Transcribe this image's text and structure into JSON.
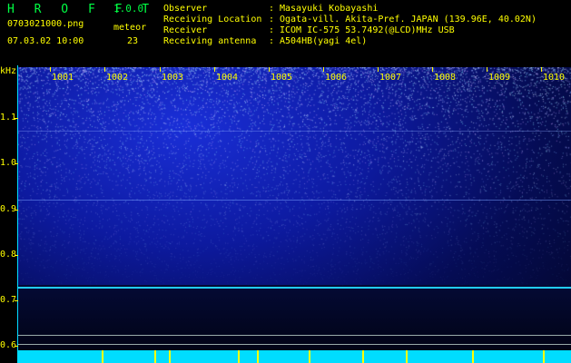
{
  "header": {
    "app_title": "H R O F F T",
    "app_version": "1.0.0",
    "file_name": "0703021000.png",
    "date_time": "07.03.02 10:00",
    "meteor_label": "meteor",
    "meteor_count": "23"
  },
  "info": [
    {
      "key": "Observer",
      "sep": ":",
      "value": "Masayuki Kobayashi"
    },
    {
      "key": "Receiving Location",
      "sep": ":",
      "value": "Ogata-vill. Akita-Pref. JAPAN (139.96E, 40.02N)"
    },
    {
      "key": "Receiver",
      "sep": ":",
      "value": "ICOM IC-575 53.7492(@LCD)MHz USB"
    },
    {
      "key": "Receiving antenna",
      "sep": ":",
      "value": "A504HB(yagi 4el)"
    }
  ],
  "spectrogram": {
    "y_unit": "kHz",
    "y_ticks": [
      "1.1",
      "1.0",
      "0.9",
      "0.8",
      "0.7",
      "0.6"
    ],
    "time_ticks": [
      "1001",
      "1002",
      "1003",
      "1004",
      "1005",
      "1006",
      "1007",
      "1008",
      "1009",
      "1010"
    ]
  },
  "colors": {
    "label": "#ffff00",
    "title": "#00ff44",
    "trace": "#00ddff"
  }
}
